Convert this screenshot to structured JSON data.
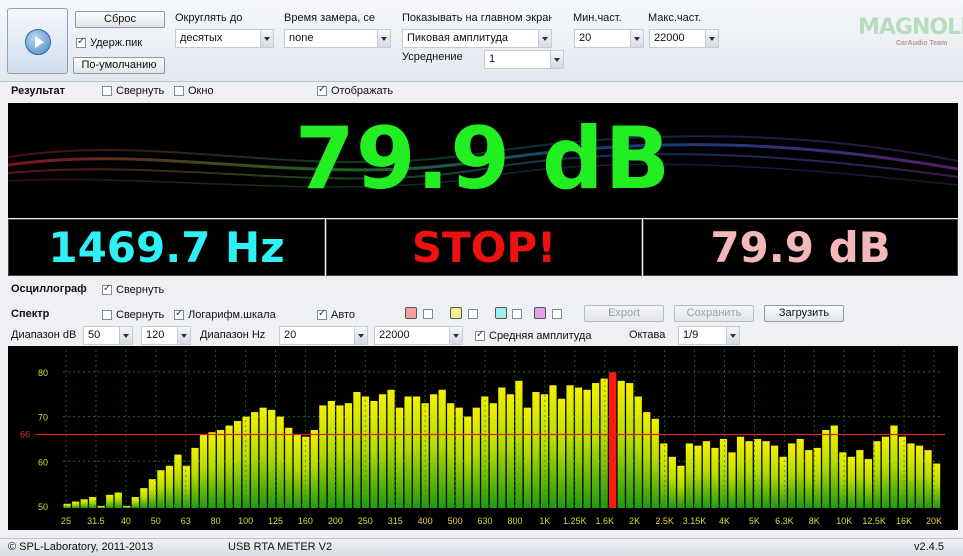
{
  "toolbar": {
    "reset_label": "Сброс",
    "hold_peak_label": "Удерж.пик",
    "hold_peak_checked": true,
    "default_label": "По-умолчанию",
    "round_label": "Округлять до",
    "round_value": "десятых",
    "measure_time_label": "Время замера, се",
    "measure_time_value": "none",
    "show_main_label": "Показывать на главном экран",
    "show_main_value": "Пиковая амплитуда",
    "averaging_label": "Усреднение",
    "averaging_value": "1",
    "min_freq_label": "Мин.част.",
    "min_freq_value": "20",
    "max_freq_label": "Макс.част.",
    "max_freq_value": "22000",
    "logo_text": "MAGNOLIA",
    "logo_sub": "CarAudio Team"
  },
  "result": {
    "title": "Результат",
    "collapse_label": "Свернуть",
    "window_label": "Окно",
    "show_label": "Отображать",
    "main_value": "79.9 dB",
    "freq_value": "1469.7 Hz",
    "status_value": "STOP!",
    "peak_value": "79.9 dB",
    "colors": {
      "main": "#22ee22",
      "freq": "#2ff0f5",
      "status": "#ee1111",
      "peak": "#f5b8b8"
    }
  },
  "oscilloscope": {
    "title": "Осциллограф",
    "collapse_label": "Свернуть"
  },
  "spectrum": {
    "title": "Спектр",
    "collapse_label": "Свернуть",
    "log_scale_label": "Логарифм.шкала",
    "auto_label": "Авто",
    "export_label": "Export",
    "save_label": "Сохранить",
    "load_label": "Загрузить",
    "db_range_label": "Диапазон dB",
    "db_min": "50",
    "db_max": "120",
    "hz_range_label": "Диапазон Hz",
    "hz_min": "20",
    "hz_max": "22000",
    "avg_amp_label": "Средняя амплитуда",
    "octave_label": "Октава",
    "octave_value": "1/9",
    "swatch_colors": [
      "#f4a0a0",
      "#f6f08a",
      "#9ef0f0",
      "#e6a0e8"
    ]
  },
  "chart_data": {
    "type": "bar",
    "title": "",
    "xlabel": "",
    "ylabel": "",
    "ylim": [
      50,
      84
    ],
    "yticks": [
      50,
      60,
      70,
      80
    ],
    "ref_line_value": 66,
    "ref_line_label": "66",
    "grid": true,
    "xtick_labels": [
      "25",
      "31.5",
      "40",
      "50",
      "63",
      "80",
      "100",
      "125",
      "160",
      "200",
      "250",
      "315",
      "400",
      "500",
      "630",
      "800",
      "1K",
      "1.25K",
      "1.6K",
      "2K",
      "2.5K",
      "3.15K",
      "4K",
      "5K",
      "6.3K",
      "8K",
      "10K",
      "12.5K",
      "16K",
      "20K"
    ],
    "values": [
      50.5,
      51.0,
      51.5,
      52.0,
      50.0,
      52.5,
      53.0,
      50.0,
      52.0,
      54.0,
      56.0,
      58.0,
      59.0,
      61.5,
      59.0,
      63.0,
      66.0,
      66.5,
      67.0,
      68.0,
      69.0,
      70.0,
      71.0,
      72.0,
      71.5,
      70.0,
      67.5,
      66.0,
      65.5,
      67.0,
      72.5,
      73.5,
      72.5,
      73.0,
      75.5,
      74.5,
      73.5,
      75.0,
      76.0,
      72.0,
      74.5,
      74.5,
      73.0,
      75.0,
      76.0,
      73.0,
      72.0,
      70.0,
      72.0,
      74.5,
      73.0,
      76.5,
      75.0,
      78.0,
      72.0,
      75.5,
      75.0,
      77.0,
      74.0,
      77.0,
      76.5,
      76.0,
      77.5,
      78.5,
      79.9,
      78.0,
      77.5,
      74.5,
      71.0,
      69.5,
      64.0,
      61.0,
      59.0,
      64.0,
      63.5,
      64.5,
      63.0,
      65.0,
      62.0,
      65.5,
      64.5,
      65.0,
      64.5,
      63.5,
      61.0,
      64.0,
      65.0,
      62.5,
      63.0,
      67.0,
      68.0,
      62.0,
      61.0,
      62.5,
      60.5,
      64.5,
      65.5,
      68.0,
      65.5,
      64.0,
      63.5,
      62.5,
      59.5
    ],
    "highlight_index": 64
  },
  "status_bar": {
    "copyright": "© SPL-Laboratory, 2011-2013",
    "app_name": "USB RTA METER V2",
    "version": "v2.4.5"
  }
}
